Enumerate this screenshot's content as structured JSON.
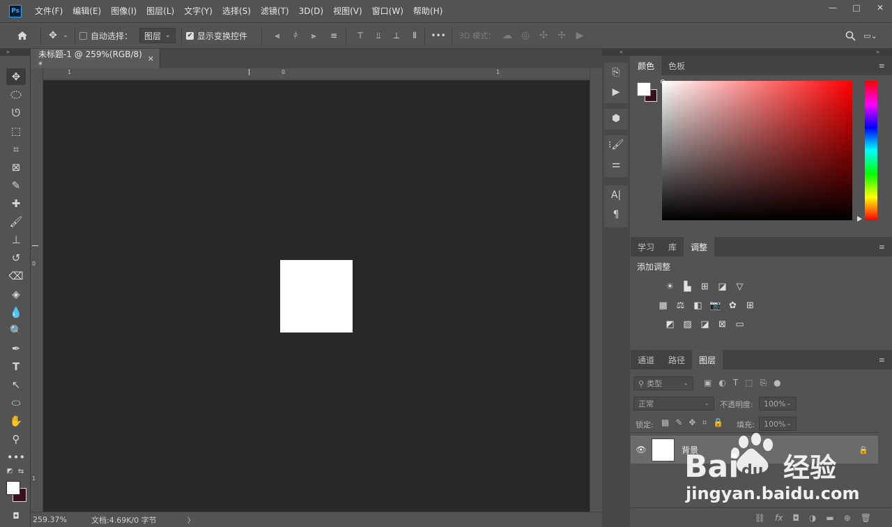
{
  "app": {
    "logo": "Ps",
    "menu": [
      "文件(F)",
      "编辑(E)",
      "图像(I)",
      "图层(L)",
      "文字(Y)",
      "选择(S)",
      "滤镜(T)",
      "3D(D)",
      "视图(V)",
      "窗口(W)",
      "帮助(H)"
    ],
    "window_controls": [
      "—",
      "□",
      "✕"
    ]
  },
  "options": {
    "auto_select_label": "自动选择：",
    "auto_select_checked": false,
    "target_value": "图层",
    "show_transform_label": "显示变换控件",
    "show_transform_checked": true,
    "more_label": "•••",
    "mode_3d_label": "3D 模式："
  },
  "document": {
    "tab_title": "未标题-1 @ 259%(RGB/8) *",
    "close_glyph": "✕",
    "ruler_h_marks": [
      "1",
      "0",
      "1"
    ],
    "ruler_v_marks": [
      "0",
      "1"
    ],
    "zoom": "259.37%",
    "doc_info": "文档:4.69K/0 字节",
    "status_arrow": "〉"
  },
  "panels": {
    "color": {
      "tabs": [
        "颜色",
        "色板"
      ],
      "active_tab": 0,
      "foreground": "#ffffff",
      "background": "#3a1020",
      "hue_color": "#ff0000"
    },
    "adjustments": {
      "tabs": [
        "学习",
        "库",
        "调整"
      ],
      "active_tab": 2,
      "title": "添加调整"
    },
    "layers": {
      "tabs": [
        "通道",
        "路径",
        "图层"
      ],
      "active_tab": 2,
      "filter_label": "类型",
      "blend_mode": "正常",
      "opacity_label": "不透明度:",
      "opacity_value": "100%",
      "lock_label": "锁定:",
      "fill_label": "填充:",
      "fill_value": "100%",
      "layer_name": "背景"
    }
  },
  "watermark": {
    "logo_text": "Bai du 经验",
    "url": "jingyan.baidu.com"
  }
}
